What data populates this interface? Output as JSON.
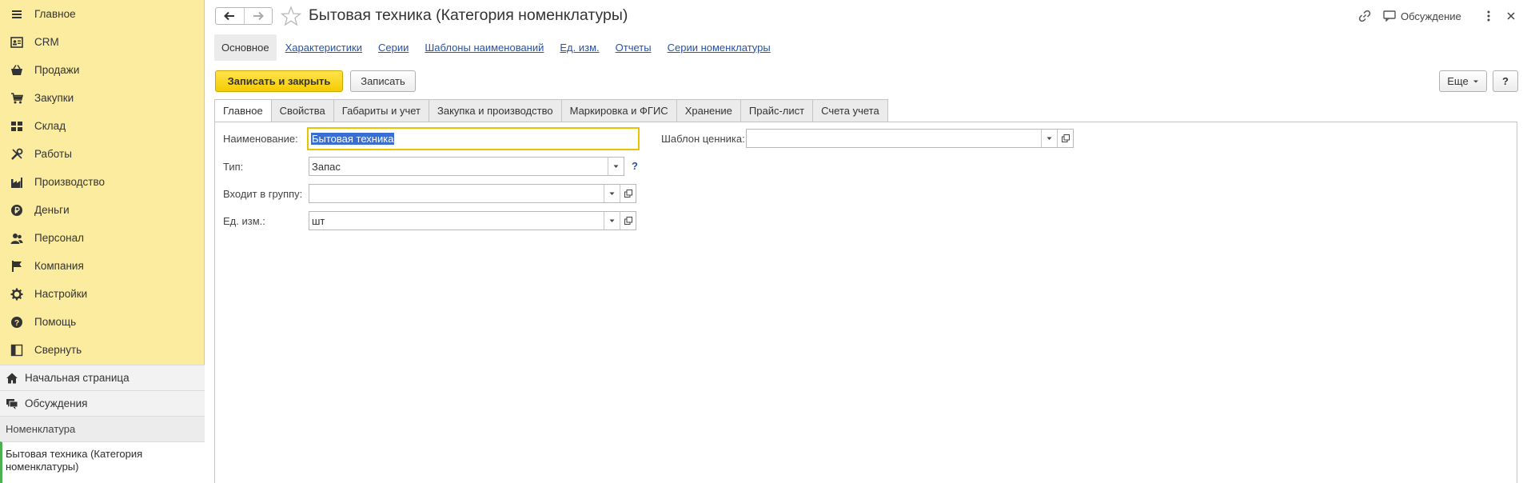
{
  "sidebar": {
    "items": [
      {
        "label": "Главное",
        "icon": "menu-icon"
      },
      {
        "label": "CRM",
        "icon": "crm-card-icon"
      },
      {
        "label": "Продажи",
        "icon": "sales-basket-icon"
      },
      {
        "label": "Закупки",
        "icon": "purchases-cart-icon"
      },
      {
        "label": "Склад",
        "icon": "warehouse-icon"
      },
      {
        "label": "Работы",
        "icon": "tools-icon"
      },
      {
        "label": "Производство",
        "icon": "factory-icon"
      },
      {
        "label": "Деньги",
        "icon": "money-ruble-icon"
      },
      {
        "label": "Персонал",
        "icon": "personnel-icon"
      },
      {
        "label": "Компания",
        "icon": "company-flag-icon"
      },
      {
        "label": "Настройки",
        "icon": "settings-gear-icon"
      },
      {
        "label": "Помощь",
        "icon": "help-icon"
      },
      {
        "label": "Свернуть",
        "icon": "collapse-icon"
      }
    ],
    "home_label": "Начальная страница",
    "discussions_label": "Обсуждения",
    "open_section_header": "Номенклатура",
    "open_window_label": "Бытовая техника (Категория номенклатуры)"
  },
  "header": {
    "title": "Бытовая техника (Категория номенклатуры)",
    "discussion_label": "Обсуждение"
  },
  "sections": {
    "active": "Основное",
    "links": [
      "Характеристики",
      "Серии",
      "Шаблоны наименований",
      "Ед. изм.",
      "Отчеты",
      "Серии номенклатуры"
    ]
  },
  "commands": {
    "save_close": "Записать и закрыть",
    "save": "Записать",
    "more": "Еще",
    "help": "?"
  },
  "tabs": [
    "Главное",
    "Свойства",
    "Габариты и учет",
    "Закупка и производство",
    "Маркировка и ФГИС",
    "Хранение",
    "Прайс-лист",
    "Счета учета"
  ],
  "form": {
    "name_label": "Наименование:",
    "name_value": "Бытовая техника",
    "type_label": "Тип:",
    "type_value": "Запас",
    "group_label": "Входит в группу:",
    "group_value": "",
    "unit_label": "Ед. изм.:",
    "unit_value": "шт",
    "price_tag_label": "Шаблон ценника:",
    "price_tag_value": "",
    "help_mark": "?"
  },
  "colors": {
    "sidebar_bg": "#fbeca0",
    "primary_button": "#f5cc00",
    "link": "#2653a4",
    "focus_border": "#e8c300"
  }
}
